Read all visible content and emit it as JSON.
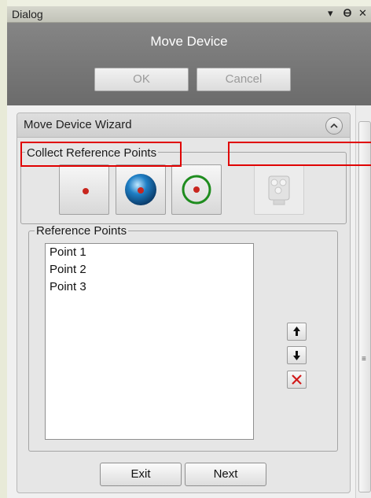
{
  "window": {
    "dialog_title": "Dialog",
    "pin_icon": "pin-icon",
    "close_icon": "close-icon",
    "menu_icon": "dropdown-arrow-icon"
  },
  "header": {
    "title": "Move Device",
    "ok_label": "OK",
    "cancel_label": "Cancel"
  },
  "wizard": {
    "title": "Move Device Wizard",
    "collect_group_title": "Collect Reference Points",
    "tools": [
      {
        "name": "point-tool",
        "icon": "red-dot-icon"
      },
      {
        "name": "sphere-tool",
        "icon": "blue-sphere-icon"
      },
      {
        "name": "circle-tool",
        "icon": "green-circle-icon"
      },
      {
        "name": "device-tool",
        "icon": "device-icon"
      }
    ],
    "reference_group_title": "Reference Points",
    "points": [
      "Point 1",
      "Point 2",
      "Point 3"
    ],
    "exit_label": "Exit",
    "next_label": "Next"
  },
  "colors": {
    "header_bg": "#787878",
    "highlight": "#e00000",
    "delete_red": "#d11a1a",
    "circle_green": "#1e8c1e"
  }
}
